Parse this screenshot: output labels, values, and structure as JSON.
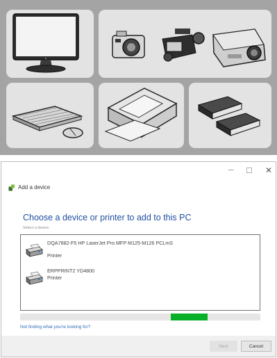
{
  "window": {
    "title": "Add a device",
    "controls": {
      "minimize": "–",
      "maximize": "☐",
      "close": "✕"
    }
  },
  "main": {
    "heading": "Choose a device or printer to add to this PC",
    "subheading": "Select a device",
    "devices": [
      {
        "name": "DQA7882-F5  HP LaserJet Pro MFP M125-M126 PCLmS",
        "type": "Printer",
        "icon": "printer-icon"
      },
      {
        "name": "ERPPRINT2  YD4800",
        "type": "Printer",
        "icon": "printer-icon"
      }
    ],
    "search_progress": {
      "indeterminate": true
    },
    "help_link": "Not finding what you're looking for?"
  },
  "footer": {
    "next_label": "Next",
    "cancel_label": "Cancel"
  },
  "banner": {
    "illustrations": [
      "monitor",
      "camera",
      "camcorder",
      "projector",
      "keyboard",
      "mouse",
      "printer",
      "external-drive"
    ]
  },
  "colors": {
    "accent": "#1f4fa0",
    "link": "#2b6cb8",
    "progress": "#07b027",
    "banner_bg": "#a4a4a4",
    "panel_bg": "#e3e3e3"
  }
}
